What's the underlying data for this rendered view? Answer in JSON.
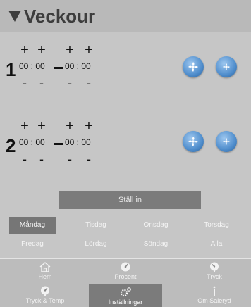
{
  "header": {
    "title": "Veckour"
  },
  "schedules": [
    {
      "number": "1",
      "start": "00 : 00",
      "end": "00 : 00"
    },
    {
      "number": "2",
      "start": "00 : 00",
      "end": "00 : 00"
    }
  ],
  "controls": {
    "plus": "+",
    "minus": "-"
  },
  "set_button": "Ställ in",
  "days": [
    "Måndag",
    "Tisdag",
    "Onsdag",
    "Torsdag",
    "Fredag",
    "Lördag",
    "Söndag",
    "Alla"
  ],
  "selected_day": "Måndag",
  "nav": {
    "home": "Hem",
    "percent": "Procent",
    "pressure": "Tryck",
    "pressure_temp": "Tryck & Temp",
    "settings": "Inställningar",
    "about": "Om Saleryd"
  },
  "colors": {
    "background": "#c6c6c6",
    "button": "#7b7b7b",
    "fan_blue": "#4f8dcc"
  }
}
